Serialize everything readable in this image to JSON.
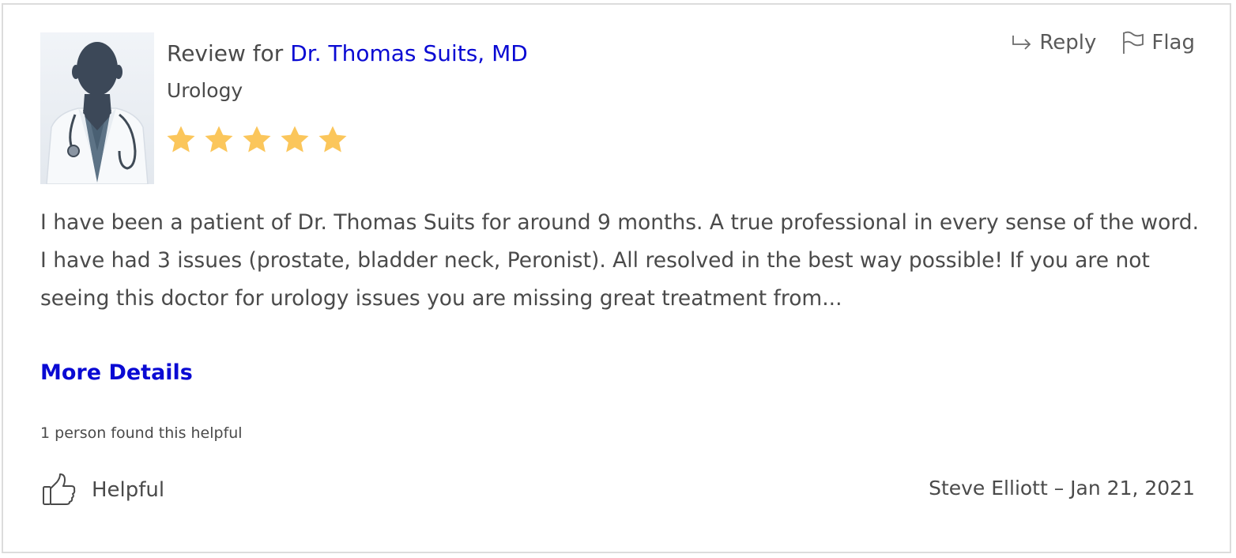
{
  "review": {
    "title_prefix": "Review for",
    "doctor_name": "Dr. Thomas Suits, MD",
    "specialty": "Urology",
    "rating": 5,
    "rating_max": 5,
    "star_color": "#fbc65b",
    "body": "I have been a patient of Dr. Thomas Suits for around 9 months. A true professional in every sense of the word. I have had 3 issues (prostate, bladder neck, Peronist). All resolved in the best way possible! If you are not seeing this doctor for urology issues you are missing great treatment from...",
    "more_details_label": "More Details",
    "helpful_count_text": "1 person found this helpful",
    "helpful_label": "Helpful",
    "byline": "Steve Elliott – Jan 21, 2021"
  },
  "actions": {
    "reply_label": "Reply",
    "reply_icon": "reply-arrow-icon",
    "flag_label": "Flag",
    "flag_icon": "flag-icon"
  },
  "colors": {
    "link": "#0a0ad3",
    "text": "#4a4a4a",
    "border": "#dcdcdc"
  },
  "avatar": {
    "icon": "doctor-silhouette-icon"
  }
}
